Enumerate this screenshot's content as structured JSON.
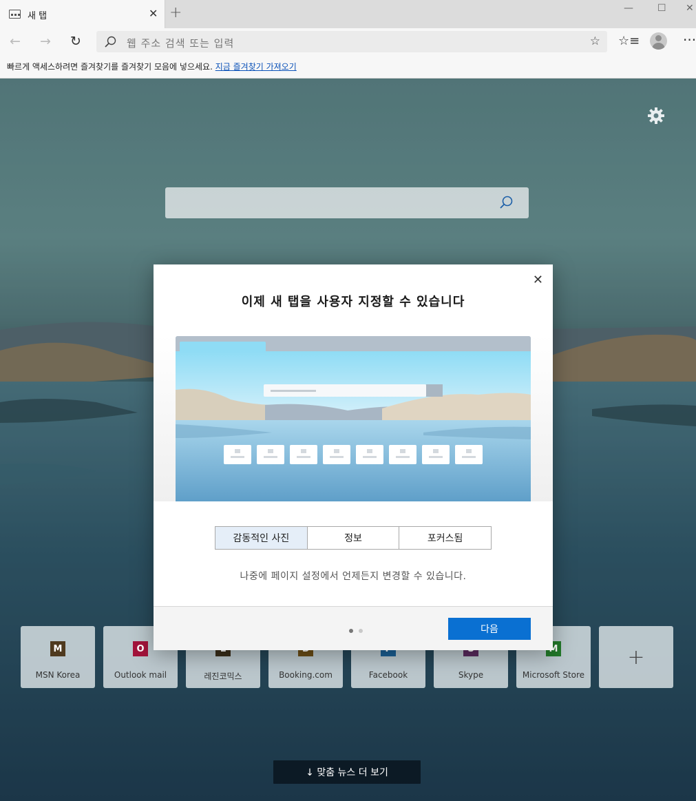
{
  "browser": {
    "tab_title": "새 탭",
    "address_placeholder": "웹 주소 검색 또는 입력",
    "favorites_bar_text": "빠르게 액세스하려면 즐겨찾기를 즐겨찾기 모음에 넣으세요.",
    "favorites_bar_link": "지금 즐겨찾기 가져오기"
  },
  "icons": {
    "tab": "newtab-page-icon",
    "close": "close-icon",
    "new_tab": "plus-icon",
    "back": "arrow-left-icon",
    "forward": "arrow-right-icon",
    "refresh": "refresh-icon",
    "search": "search-icon",
    "favorite": "star-icon",
    "favorites": "favorites-list-icon",
    "profile": "profile-icon",
    "more": "more-icon",
    "settings": "gear-icon"
  },
  "quick_links": [
    {
      "label": "MSN Korea",
      "letter": "M",
      "color": "#4f3a1f"
    },
    {
      "label": "Outlook mail",
      "letter": "O",
      "color": "#a3133b"
    },
    {
      "label": "레진코믹스",
      "letter": "L",
      "color": "#3a2e1a"
    },
    {
      "label": "Booking.com",
      "letter": "B",
      "color": "#6b4d16"
    },
    {
      "label": "Facebook",
      "letter": "F",
      "color": "#1a5f94"
    },
    {
      "label": "Skype",
      "letter": "S",
      "color": "#5a2a5e"
    },
    {
      "label": "Microsoft Store",
      "letter": "M",
      "color": "#237a2a"
    }
  ],
  "news_button": "↓ 맞춤 뉴스 더 보기",
  "modal": {
    "title": "이제 새 탭을 사용자 지정할 수 있습니다",
    "options": [
      "감동적인 사진",
      "정보",
      "포커스됨"
    ],
    "selected_option": "감동적인 사진",
    "note": "나중에 페이지 설정에서 언제든지 변경할 수 있습니다.",
    "next_button": "다음",
    "page_indicator": {
      "current": 1,
      "total": 2
    }
  },
  "colors": {
    "accent": "#0a70d2",
    "link": "#0a51b8"
  }
}
